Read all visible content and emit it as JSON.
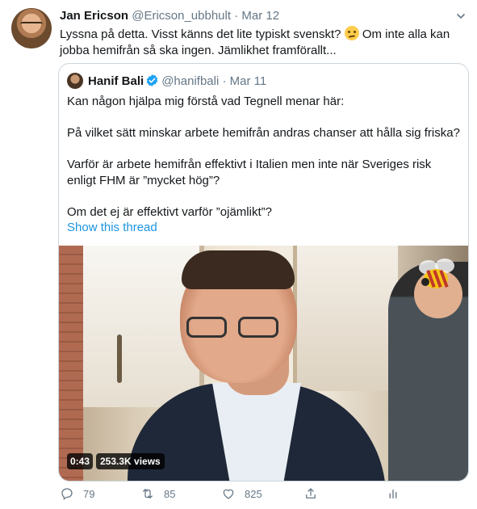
{
  "tweet": {
    "author_name": "Jan Ericson",
    "author_handle": "@Ericson_ubbhult",
    "separator": "·",
    "date": "Mar 12",
    "text_part1": "Lyssna på detta. Visst känns det lite typiskt svenskt?",
    "text_part2": " Om inte alla kan jobba hemifrån så ska ingen. Jämlikhet framförallt...",
    "emoji_icon": "confused-face-emoji"
  },
  "quoted": {
    "author_name": "Hanif Bali",
    "author_handle": "@hanifbali",
    "separator": "·",
    "date": "Mar 11",
    "paragraphs": [
      "Kan någon hjälpa mig förstå vad Tegnell menar här:",
      "På vilket sätt minskar arbete hemifrån andras chanser att hålla sig friska?",
      "Varför är arbete hemifrån effektivt i Italien men inte när Sveriges risk enligt FHM är ”mycket hög”?",
      "Om det ej är effektivt varför ”ojämlikt”?"
    ],
    "show_thread": "Show this thread",
    "video": {
      "duration": "0:43",
      "views": "253.3K views"
    }
  },
  "actions": {
    "replies": "79",
    "retweets": "85",
    "likes": "825"
  },
  "colors": {
    "link": "#1b95e0",
    "muted": "#657786",
    "verified": "#1da1f2",
    "border": "#ccd6dd"
  }
}
